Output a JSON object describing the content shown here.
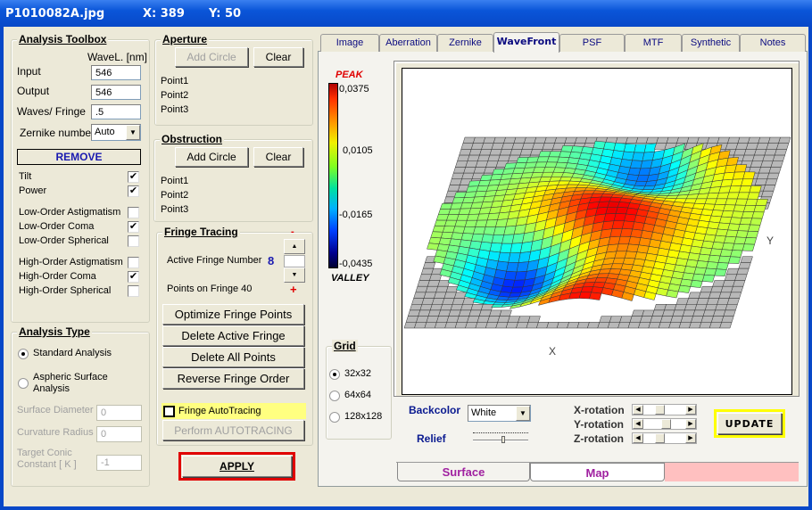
{
  "window": {
    "filename": "P1010082A.jpg",
    "x_label": "X: 389",
    "y_label": "Y: 50"
  },
  "toolbox": {
    "title": "Analysis Toolbox",
    "wavel_header": "WaveL. [nm]",
    "input_label": "Input",
    "input_value": "546",
    "output_label": "Output",
    "output_value": "546",
    "waves_label": "Waves/ Fringe",
    "waves_value": ".5",
    "zernike_label": "Zernike number",
    "zernike_value": "Auto",
    "remove_label": "REMOVE",
    "checks": [
      {
        "label": "Tilt",
        "checked": true
      },
      {
        "label": "Power",
        "checked": true
      },
      {
        "label": "Low-Order  Astigmatism",
        "checked": false
      },
      {
        "label": "Low-Order  Coma",
        "checked": true
      },
      {
        "label": "Low-Order  Spherical",
        "checked": false
      },
      {
        "label": "High-Order  Astigmatism",
        "checked": false
      },
      {
        "label": "High-Order  Coma",
        "checked": true
      },
      {
        "label": "High-Order  Spherical",
        "checked": false
      }
    ]
  },
  "analysis_type": {
    "title": "Analysis Type",
    "standard": "Standard Analysis",
    "aspheric_1": "Aspheric  Surface",
    "aspheric_2": "Analysis",
    "selected": "standard",
    "surface_diameter_label": "Surface Diameter",
    "surface_diameter": "0",
    "curvature_label": "Curvature Radius",
    "curvature": "0",
    "conic_label_1": "Target Conic",
    "conic_label_2": "Constant [ K ]",
    "conic": "-1"
  },
  "aperture": {
    "title": "Aperture",
    "add": "Add Circle",
    "clear": "Clear",
    "points": [
      "Point1",
      "Point2",
      "Point3"
    ]
  },
  "obstruction": {
    "title": "Obstruction",
    "add": "Add Circle",
    "clear": "Clear",
    "points": [
      "Point1",
      "Point2",
      "Point3"
    ]
  },
  "fringe": {
    "title": "Fringe Tracing",
    "active_label": "Active Fringe Number",
    "active_value": "8",
    "minus": "-",
    "plus": "+",
    "points_label": "Points on  Fringe 40",
    "optimize": "Optimize Fringe Points",
    "delete_active": "Delete Active Fringe",
    "delete_all": "Delete  All  Points",
    "reverse": "Reverse  Fringe Order",
    "autotracing_label": "Fringe AutoTracing",
    "autotracing_checked": false,
    "perform": "Perform  AUTOTRACING"
  },
  "apply": "APPLY",
  "tabs": [
    {
      "label": "Image"
    },
    {
      "label": "Aberration"
    },
    {
      "label": "Zernike"
    },
    {
      "label": "WaveFront",
      "selected": true
    },
    {
      "label": "PSF"
    },
    {
      "label": "MTF"
    },
    {
      "label": "Synthetic"
    },
    {
      "label": "Notes"
    }
  ],
  "colorbar": {
    "peak": "PEAK",
    "valley": "VALLEY",
    "ticks": [
      "0,0375",
      "0,0105",
      "-0,0165",
      "-0,0435"
    ],
    "max": 0.0375,
    "min": -0.0435
  },
  "plot": {
    "x_axis": "X",
    "y_axis": "Y"
  },
  "grid": {
    "title": "Grid",
    "options": [
      "32x32",
      "64x64",
      "128x128"
    ],
    "selected": "32x32"
  },
  "controls": {
    "backcolor_label": "Backcolor",
    "backcolor_value": "White",
    "relief_label": "Relief",
    "relief_level": 0.55,
    "x_rot_label": "X-rotation",
    "y_rot_label": "Y-rotation",
    "z_rot_label": "Z-rotation",
    "x_rot": 0.35,
    "y_rot": 0.55,
    "z_rot": 0.35,
    "update": "UPDATE"
  },
  "bottom_tabs": [
    {
      "label": "Surface",
      "selected": true
    },
    {
      "label": "Map"
    }
  ],
  "colors": {
    "accent_red": "#e00000",
    "highlight_yellow": "#ffff00",
    "tab_text": "#a020a0",
    "blue_label": "#0a1a90"
  }
}
